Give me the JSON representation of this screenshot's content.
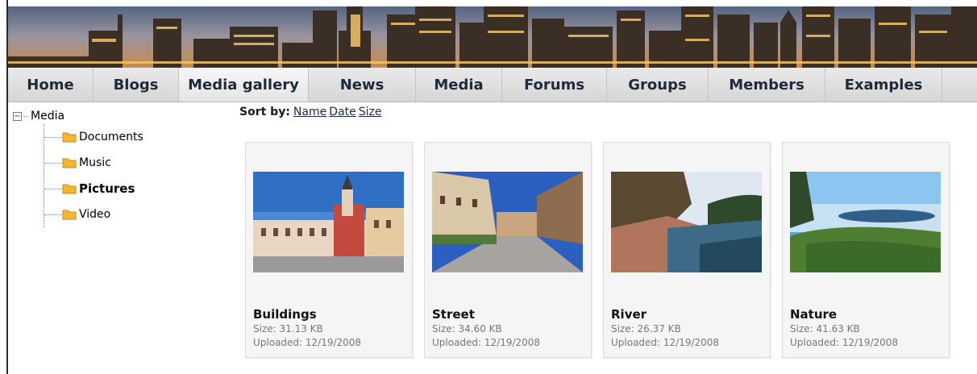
{
  "nav": {
    "items": [
      {
        "label": "Home"
      },
      {
        "label": "Blogs"
      },
      {
        "label": "Media gallery"
      },
      {
        "label": "News"
      },
      {
        "label": "Media"
      },
      {
        "label": "Forums"
      },
      {
        "label": "Groups"
      },
      {
        "label": "Members"
      },
      {
        "label": "Examples"
      }
    ],
    "active": "Media gallery"
  },
  "tree": {
    "root": {
      "label": "Media",
      "toggle": "−"
    },
    "children": [
      {
        "label": "Documents"
      },
      {
        "label": "Music"
      },
      {
        "label": "Pictures",
        "selected": true
      },
      {
        "label": "Video"
      }
    ],
    "folder_color": "#f2b632"
  },
  "sort": {
    "title": "Sort by:",
    "options": [
      "Name",
      "Date",
      "Size"
    ]
  },
  "gallery": {
    "items": [
      {
        "title": "Buildings",
        "size": "Size:  31.13 KB",
        "uploaded": "Uploaded: 12/19/2008"
      },
      {
        "title": "Street",
        "size": "Size:  34.60 KB",
        "uploaded": "Uploaded: 12/19/2008"
      },
      {
        "title": "River",
        "size": "Size:  26.37 KB",
        "uploaded": "Uploaded: 12/19/2008"
      },
      {
        "title": "Nature",
        "size": "Size:  41.63 KB",
        "uploaded": "Uploaded: 12/19/2008"
      }
    ]
  }
}
